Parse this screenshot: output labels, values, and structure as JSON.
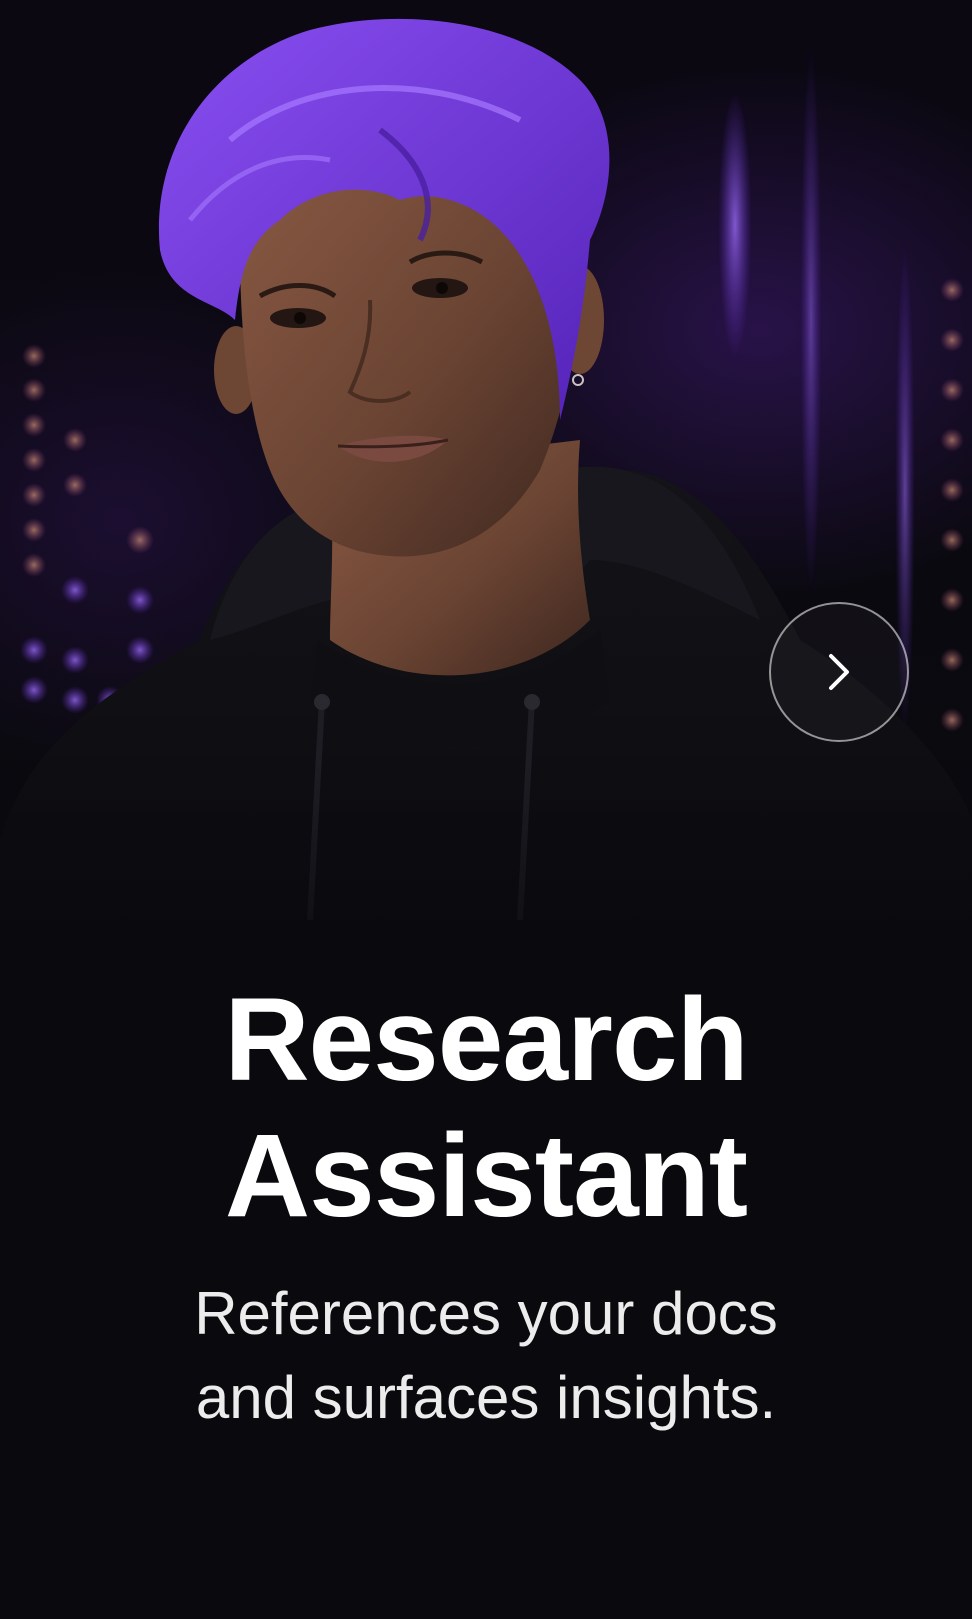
{
  "hero": {
    "title_line1": "Research",
    "title_line2": "Assistant",
    "subtitle_line1": "References your docs",
    "subtitle_line2": "and surfaces insights.",
    "image_subject": "portrait of a man with purple hair in a black hoodie",
    "next_icon": "chevron-right-icon"
  },
  "colors": {
    "background": "#0a0a0e",
    "accent_purple": "#6a2fd6",
    "text": "#ffffff"
  }
}
